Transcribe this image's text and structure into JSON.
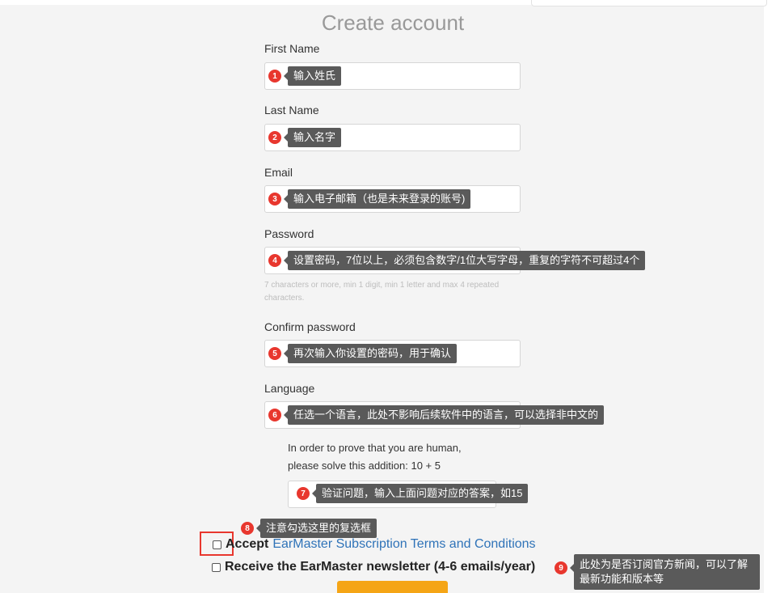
{
  "form": {
    "title": "Create account",
    "first_name_label": "First Name",
    "last_name_label": "Last Name",
    "email_label": "Email",
    "password_label": "Password",
    "password_hint": "7 characters or more, min 1 digit, min 1 letter and max 4 repeated characters.",
    "confirm_password_label": "Confirm password",
    "language_label": "Language",
    "captcha_line1": "In order to prove that you are human,",
    "captcha_line2": "please solve this addition: 10 + 5",
    "accept_word": "Accept",
    "terms_link": "EarMaster Subscription Terms and Conditions",
    "newsletter_label": "Receive the EarMaster newsletter (4-6 emails/year)"
  },
  "annotations": [
    {
      "num": "1",
      "text": "输入姓氏"
    },
    {
      "num": "2",
      "text": "输入名字"
    },
    {
      "num": "3",
      "text": "输入电子邮箱（也是未来登录的账号)"
    },
    {
      "num": "4",
      "text": "设置密码，7位以上，必须包含数字/1位大写字母，重复的字符不可超过4个"
    },
    {
      "num": "5",
      "text": "再次输入你设置的密码，用于确认"
    },
    {
      "num": "6",
      "text": "任选一个语言，此处不影响后续软件中的语言，可以选择非中文的"
    },
    {
      "num": "7",
      "text": "验证问题，输入上面问题对应的答案，如15"
    },
    {
      "num": "8",
      "text": "注意勾选这里的复选框"
    },
    {
      "num": "9",
      "text": "此处为是否订阅官方新闻，可以了解最新功能和版本等"
    }
  ],
  "colors": {
    "accent_link": "#2f73b8",
    "annotation_badge": "#e8372e",
    "annotation_bubble": "#5a5a5a",
    "submit_button": "#f5a516"
  }
}
